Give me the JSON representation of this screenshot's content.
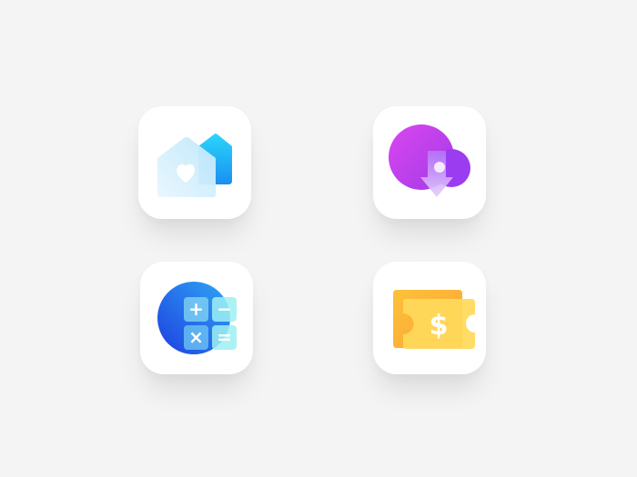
{
  "icons": [
    {
      "name": "home-heart",
      "colors": {
        "back": "#1ea8f5",
        "back_top": "#26d0fb",
        "front": "#dff2fd",
        "heart": "#ffffff"
      }
    },
    {
      "name": "cloud-download",
      "colors": {
        "circle_from": "#d946ef",
        "circle_to": "#9333ea",
        "arrow": "#c8a2f8",
        "dot": "#f3e8ff"
      }
    },
    {
      "name": "calculator",
      "colors": {
        "circle_from": "#1d4ed8",
        "circle_to": "#38bdf8",
        "keys": "#7fe3f0"
      },
      "keys": [
        "+",
        "−",
        "×",
        "="
      ]
    },
    {
      "name": "ticket-dollar",
      "colors": {
        "back": "#fbb03b",
        "front": "#ffd95a"
      },
      "symbol": "$"
    }
  ]
}
